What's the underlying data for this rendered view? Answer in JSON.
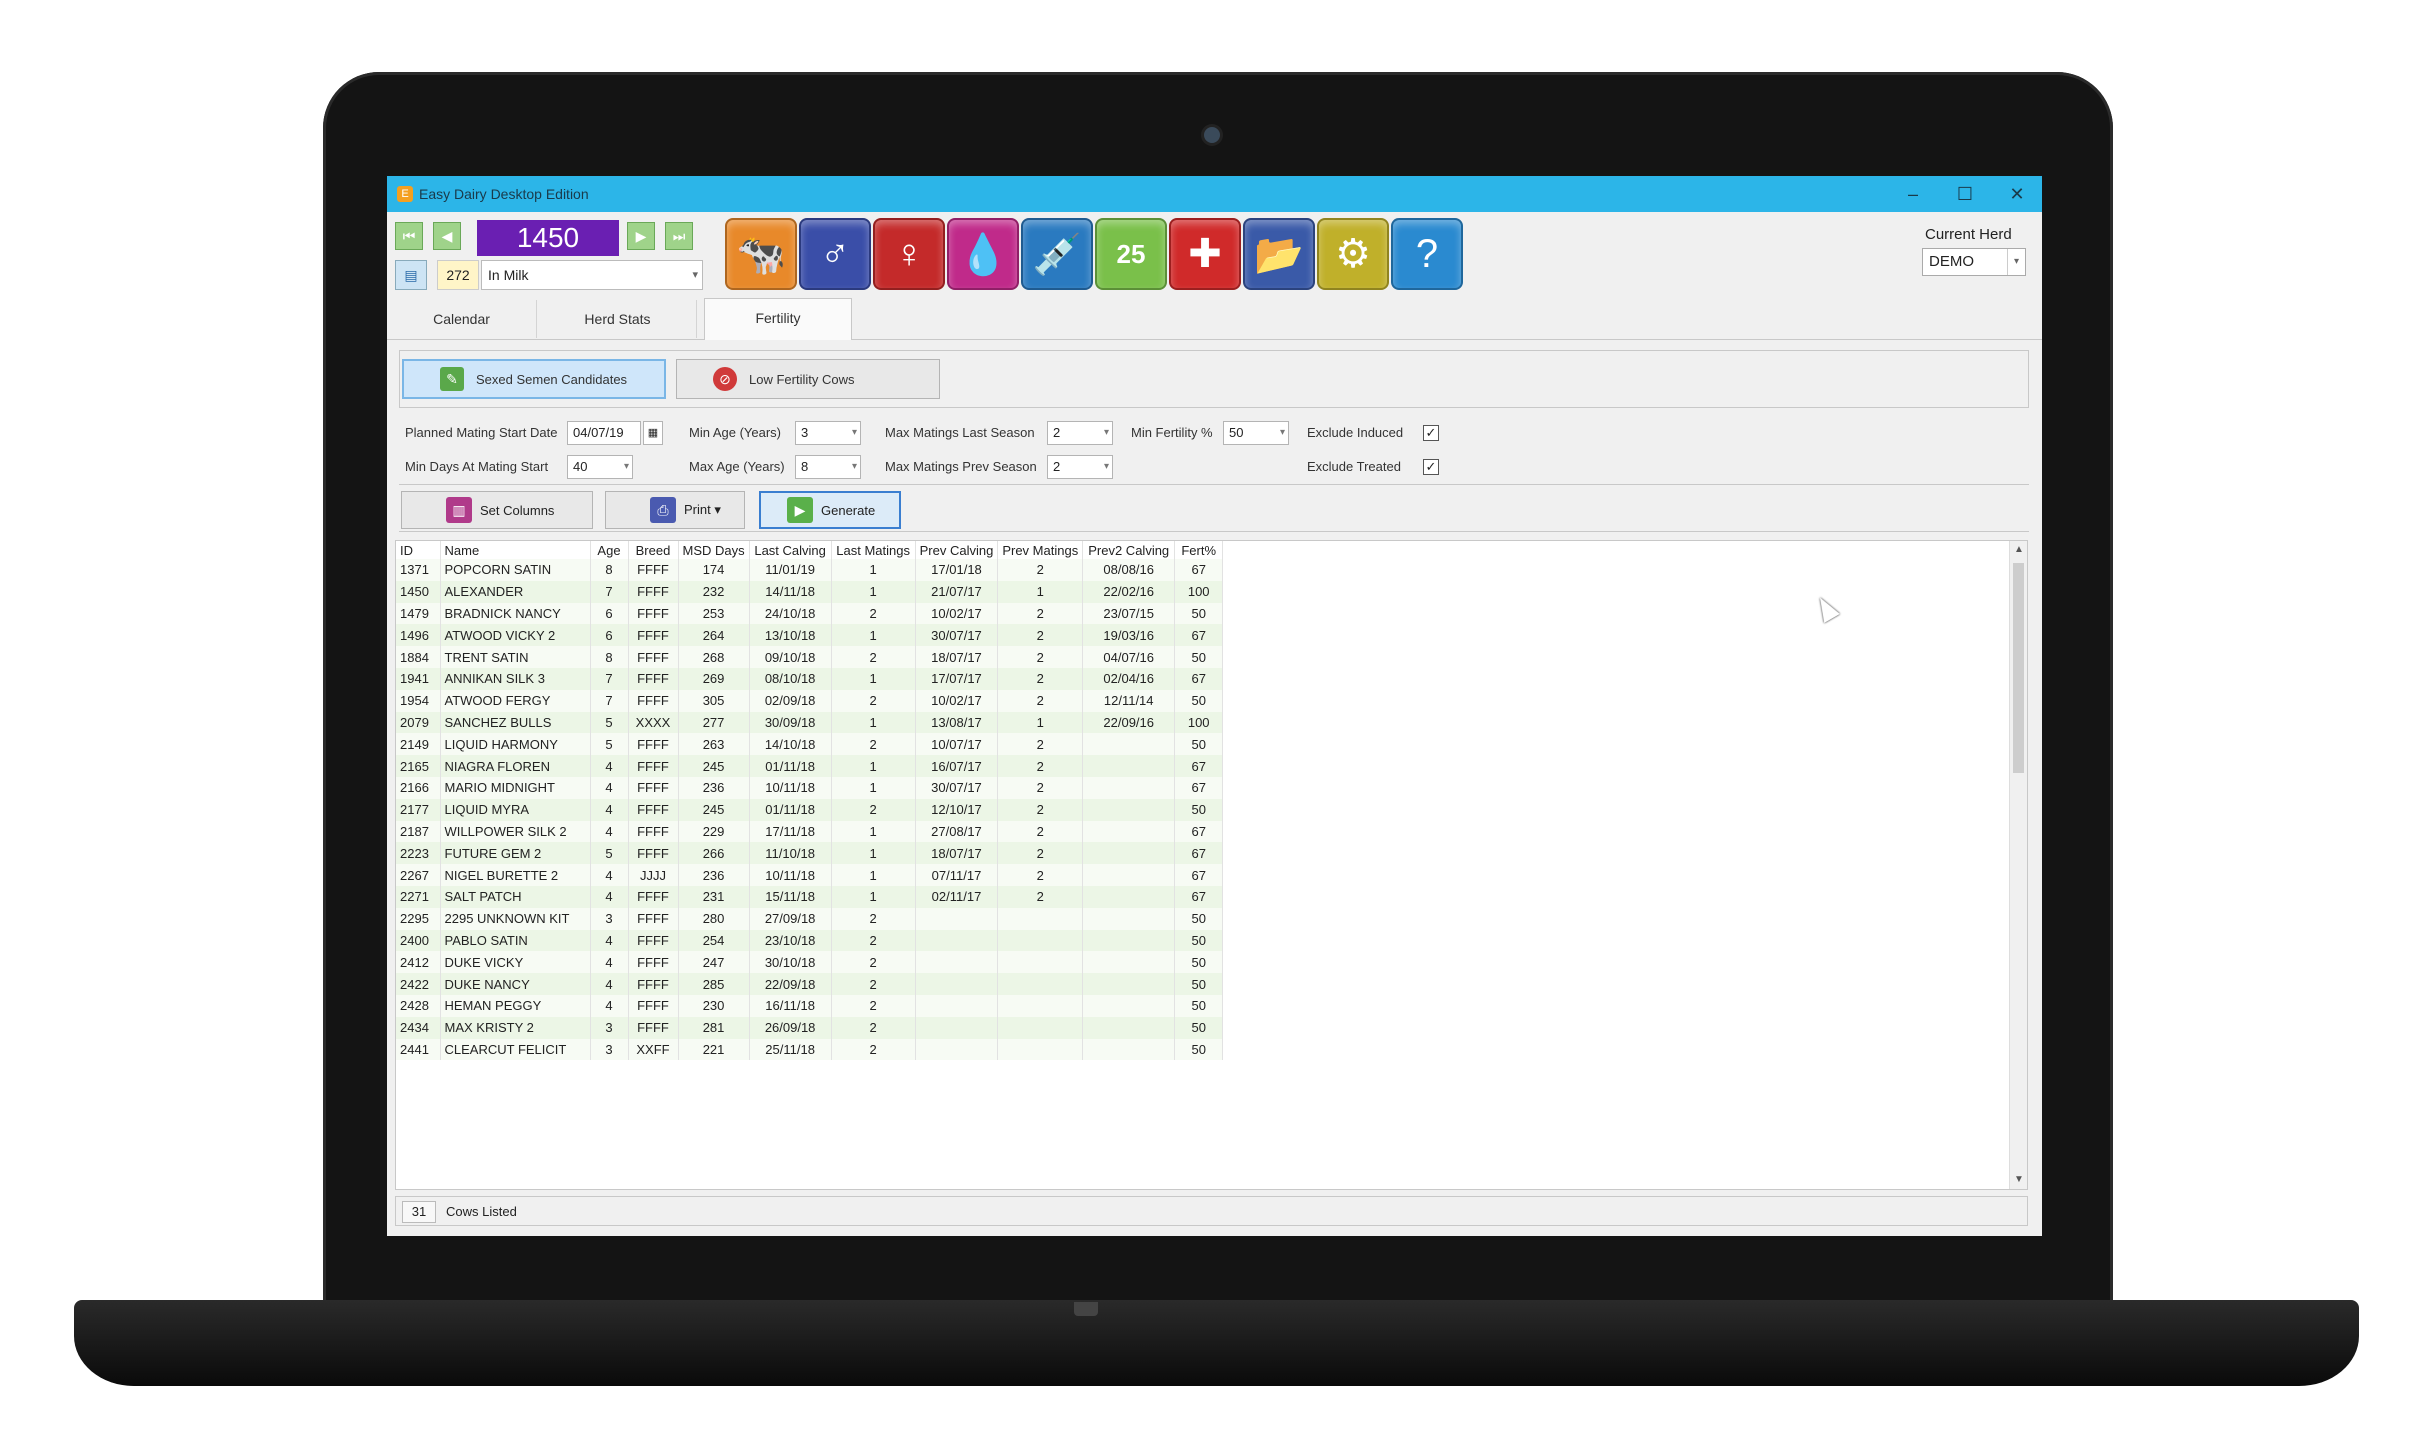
{
  "window": {
    "title": "Easy Dairy Desktop Edition",
    "min": "–",
    "max": "☐",
    "close": "✕"
  },
  "nav": {
    "cow_id": "1450",
    "count": "272",
    "status": "In Milk",
    "first": "⏮",
    "prev": "◀",
    "next": "▶",
    "last": "⏭"
  },
  "toolbar_icons": [
    {
      "name": "cow-icon",
      "glyph": "🐄",
      "color": "#e8892a"
    },
    {
      "name": "male-icon",
      "glyph": "♂",
      "color": "#3a4ea8"
    },
    {
      "name": "female-icon",
      "glyph": "♀",
      "color": "#c42a2a"
    },
    {
      "name": "drop-icon",
      "glyph": "💧",
      "color": "#c02a8a"
    },
    {
      "name": "syringe-icon",
      "glyph": "💉",
      "color": "#2a7ac0"
    },
    {
      "name": "calendar-icon",
      "glyph": "25",
      "color": "#7ac04a"
    },
    {
      "name": "medical-icon",
      "glyph": "✚",
      "color": "#d02a2a"
    },
    {
      "name": "folder-icon",
      "glyph": "📂",
      "color": "#3a5aa8"
    },
    {
      "name": "gear-icon",
      "glyph": "⚙",
      "color": "#c0b02a"
    },
    {
      "name": "help-icon",
      "glyph": "?",
      "color": "#2a8ad0"
    }
  ],
  "herd": {
    "label": "Current Herd",
    "value": "DEMO"
  },
  "tabs": [
    "Calendar",
    "Herd Stats",
    "Fertility"
  ],
  "report_buttons": {
    "sexed": "Sexed Semen Candidates",
    "low": "Low Fertility Cows"
  },
  "filters": {
    "planned_mating_label": "Planned Mating Start Date",
    "planned_mating_value": "04/07/19",
    "min_days_label": "Min Days At Mating Start",
    "min_days_value": "40",
    "min_age_label": "Min Age (Years)",
    "min_age_value": "3",
    "max_age_label": "Max Age (Years)",
    "max_age_value": "8",
    "max_last_label": "Max Matings Last Season",
    "max_last_value": "2",
    "max_prev_label": "Max Matings Prev Season",
    "max_prev_value": "2",
    "min_fert_label": "Min Fertility %",
    "min_fert_value": "50",
    "exclude_induced_label": "Exclude Induced",
    "exclude_treated_label": "Exclude Treated"
  },
  "actions": {
    "set_columns": "Set Columns",
    "print": "Print ▾",
    "generate": "Generate"
  },
  "table": {
    "columns": [
      "ID",
      "Name",
      "Age",
      "Breed",
      "MSD Days",
      "Last Calving",
      "Last Matings",
      "Prev Calving",
      "Prev Matings",
      "Prev2 Calving",
      "Fert%"
    ],
    "rows": [
      [
        "1371",
        "POPCORN SATIN",
        "8",
        "FFFF",
        "174",
        "11/01/19",
        "1",
        "17/01/18",
        "2",
        "08/08/16",
        "67"
      ],
      [
        "1450",
        "ALEXANDER",
        "7",
        "FFFF",
        "232",
        "14/11/18",
        "1",
        "21/07/17",
        "1",
        "22/02/16",
        "100"
      ],
      [
        "1479",
        "BRADNICK NANCY",
        "6",
        "FFFF",
        "253",
        "24/10/18",
        "2",
        "10/02/17",
        "2",
        "23/07/15",
        "50"
      ],
      [
        "1496",
        "ATWOOD VICKY 2",
        "6",
        "FFFF",
        "264",
        "13/10/18",
        "1",
        "30/07/17",
        "2",
        "19/03/16",
        "67"
      ],
      [
        "1884",
        "TRENT SATIN",
        "8",
        "FFFF",
        "268",
        "09/10/18",
        "2",
        "18/07/17",
        "2",
        "04/07/16",
        "50"
      ],
      [
        "1941",
        "ANNIKAN SILK 3",
        "7",
        "FFFF",
        "269",
        "08/10/18",
        "1",
        "17/07/17",
        "2",
        "02/04/16",
        "67"
      ],
      [
        "1954",
        "ATWOOD FERGY",
        "7",
        "FFFF",
        "305",
        "02/09/18",
        "2",
        "10/02/17",
        "2",
        "12/11/14",
        "50"
      ],
      [
        "2079",
        "SANCHEZ BULLS",
        "5",
        "XXXX",
        "277",
        "30/09/18",
        "1",
        "13/08/17",
        "1",
        "22/09/16",
        "100"
      ],
      [
        "2149",
        "LIQUID HARMONY",
        "5",
        "FFFF",
        "263",
        "14/10/18",
        "2",
        "10/07/17",
        "2",
        "",
        "50"
      ],
      [
        "2165",
        "NIAGRA FLOREN",
        "4",
        "FFFF",
        "245",
        "01/11/18",
        "1",
        "16/07/17",
        "2",
        "",
        "67"
      ],
      [
        "2166",
        "MARIO MIDNIGHT",
        "4",
        "FFFF",
        "236",
        "10/11/18",
        "1",
        "30/07/17",
        "2",
        "",
        "67"
      ],
      [
        "2177",
        "LIQUID MYRA",
        "4",
        "FFFF",
        "245",
        "01/11/18",
        "2",
        "12/10/17",
        "2",
        "",
        "50"
      ],
      [
        "2187",
        "WILLPOWER SILK 2",
        "4",
        "FFFF",
        "229",
        "17/11/18",
        "1",
        "27/08/17",
        "2",
        "",
        "67"
      ],
      [
        "2223",
        "FUTURE GEM 2",
        "5",
        "FFFF",
        "266",
        "11/10/18",
        "1",
        "18/07/17",
        "2",
        "",
        "67"
      ],
      [
        "2267",
        "NIGEL BURETTE 2",
        "4",
        "JJJJ",
        "236",
        "10/11/18",
        "1",
        "07/11/17",
        "2",
        "",
        "67"
      ],
      [
        "2271",
        "SALT PATCH",
        "4",
        "FFFF",
        "231",
        "15/11/18",
        "1",
        "02/11/17",
        "2",
        "",
        "67"
      ],
      [
        "2295",
        "2295 UNKNOWN KIT",
        "3",
        "FFFF",
        "280",
        "27/09/18",
        "2",
        "",
        "",
        "",
        "50"
      ],
      [
        "2400",
        "PABLO SATIN",
        "4",
        "FFFF",
        "254",
        "23/10/18",
        "2",
        "",
        "",
        "",
        "50"
      ],
      [
        "2412",
        "DUKE VICKY",
        "4",
        "FFFF",
        "247",
        "30/10/18",
        "2",
        "",
        "",
        "",
        "50"
      ],
      [
        "2422",
        "DUKE NANCY",
        "4",
        "FFFF",
        "285",
        "22/09/18",
        "2",
        "",
        "",
        "",
        "50"
      ],
      [
        "2428",
        "HEMAN PEGGY",
        "4",
        "FFFF",
        "230",
        "16/11/18",
        "2",
        "",
        "",
        "",
        "50"
      ],
      [
        "2434",
        "MAX KRISTY 2",
        "3",
        "FFFF",
        "281",
        "26/09/18",
        "2",
        "",
        "",
        "",
        "50"
      ],
      [
        "2441",
        "CLEARCUT FELICIT",
        "3",
        "XXFF",
        "221",
        "25/11/18",
        "2",
        "",
        "",
        "",
        "50"
      ]
    ]
  },
  "status": {
    "count": "31",
    "label": "Cows Listed"
  }
}
